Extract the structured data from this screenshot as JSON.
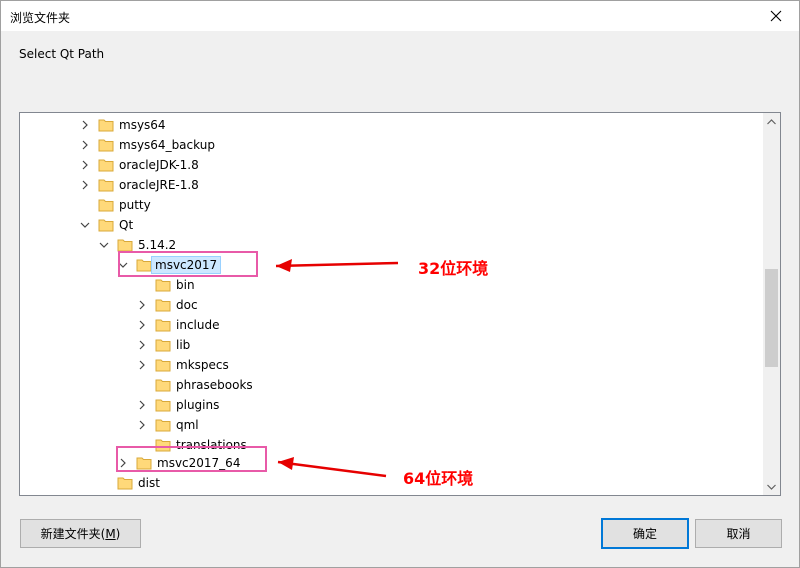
{
  "window": {
    "title": "浏览文件夹",
    "close_icon": "close-icon"
  },
  "description": "Select Qt Path",
  "tree": {
    "items": [
      {
        "label": "msys64",
        "expander": "collapsed"
      },
      {
        "label": "msys64_backup",
        "expander": "collapsed"
      },
      {
        "label": "oracleJDK-1.8",
        "expander": "collapsed"
      },
      {
        "label": "oracleJRE-1.8",
        "expander": "collapsed"
      },
      {
        "label": "putty",
        "expander": "none"
      },
      {
        "label": "Qt",
        "expander": "expanded"
      },
      {
        "label": "5.14.2",
        "expander": "expanded"
      },
      {
        "label": "msvc2017",
        "expander": "expanded",
        "selected": true
      },
      {
        "label": "bin",
        "expander": "none"
      },
      {
        "label": "doc",
        "expander": "collapsed"
      },
      {
        "label": "include",
        "expander": "collapsed"
      },
      {
        "label": "lib",
        "expander": "collapsed"
      },
      {
        "label": "mkspecs",
        "expander": "collapsed"
      },
      {
        "label": "phrasebooks",
        "expander": "none"
      },
      {
        "label": "plugins",
        "expander": "collapsed"
      },
      {
        "label": "qml",
        "expander": "collapsed"
      },
      {
        "label": "translations",
        "expander": "none"
      },
      {
        "label": "msvc2017_64",
        "expander": "collapsed"
      },
      {
        "label": "dist",
        "expander": "none"
      }
    ]
  },
  "annotations": {
    "label_32": "32位环境",
    "label_64": "64位环境",
    "color": "#ff0000",
    "box_color": "#e85aa8"
  },
  "buttons": {
    "new_folder_prefix": "新建文件夹(",
    "new_folder_key": "M",
    "new_folder_suffix": ")",
    "ok": "确定",
    "cancel": "取消"
  },
  "colors": {
    "accent": "#0078d7",
    "selection": "#cce8ff",
    "folder": "#ffd97a"
  }
}
